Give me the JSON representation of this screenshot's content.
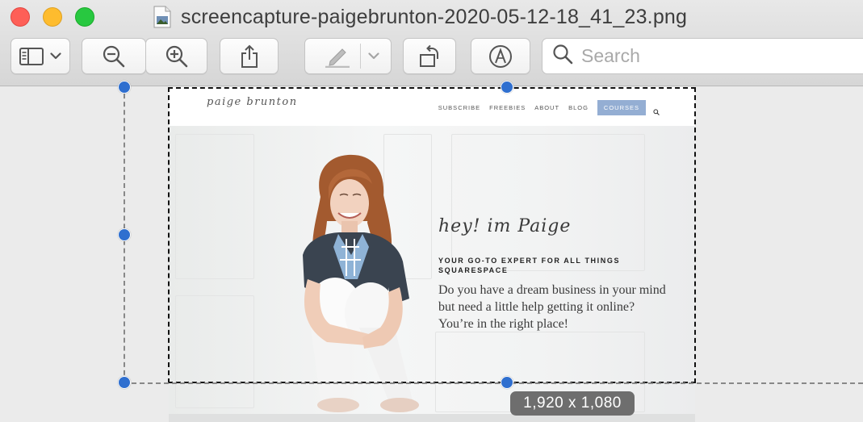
{
  "window": {
    "title": "screencapture-paigebrunton-2020-05-12-18_41_23.png"
  },
  "toolbar": {
    "buttons": [
      {
        "name": "sidebar-toggle",
        "icon": "sidebar-icon"
      },
      {
        "name": "zoom-out",
        "icon": "zoom-out-icon"
      },
      {
        "name": "zoom-in",
        "icon": "zoom-in-icon"
      },
      {
        "name": "share",
        "icon": "share-icon"
      },
      {
        "name": "markup-highlight",
        "icon": "highlighter-icon"
      },
      {
        "name": "rotate",
        "icon": "rotate-left-icon"
      },
      {
        "name": "markup",
        "icon": "pen-circle-icon"
      }
    ],
    "search_placeholder": "Search"
  },
  "site": {
    "logo": "paige brunton",
    "nav": [
      "SUBSCRIBE",
      "FREEBIES",
      "ABOUT",
      "BLOG",
      "COURSES"
    ],
    "active_nav": "COURSES",
    "accent_color": "#94aed3",
    "hero": {
      "greeting": "hey! im Paige",
      "tagline": "YOUR GO-TO EXPERT FOR ALL THINGS SQUARESPACE",
      "body": "Do you have a dream business in your mind but need a little help getting it online? You’re in the right place!"
    }
  },
  "selection": {
    "size_label": "1,920 x 1,080",
    "handle_color": "#2f6fcf"
  }
}
